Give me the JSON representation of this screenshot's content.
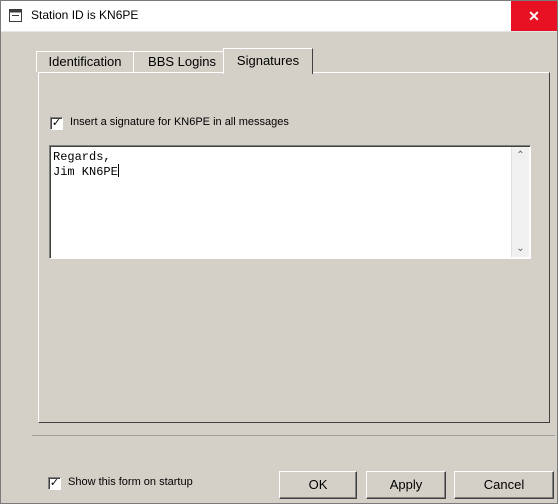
{
  "window": {
    "title": "Station ID is KN6PE",
    "close_glyph": "✕"
  },
  "tabs": [
    {
      "label": "Identification",
      "active": false
    },
    {
      "label": "BBS Logins",
      "active": false
    },
    {
      "label": "Signatures",
      "active": true
    }
  ],
  "signatures": {
    "insert_checkbox_label": "Insert a signature for KN6PE in all messages",
    "insert_checked": true,
    "signature_line1": "Regards,",
    "signature_line2": "Jim KN6PE"
  },
  "footer": {
    "show_on_startup_label": "Show this form on startup",
    "show_on_startup_checked": true,
    "ok_label": "OK",
    "apply_label": "Apply",
    "cancel_label": "Cancel"
  },
  "glyphs": {
    "check": "✓",
    "scroll_up": "⌃",
    "scroll_down": "⌄"
  },
  "icons": {
    "app_icon": "window-app-icon",
    "close_icon": "close-icon"
  }
}
